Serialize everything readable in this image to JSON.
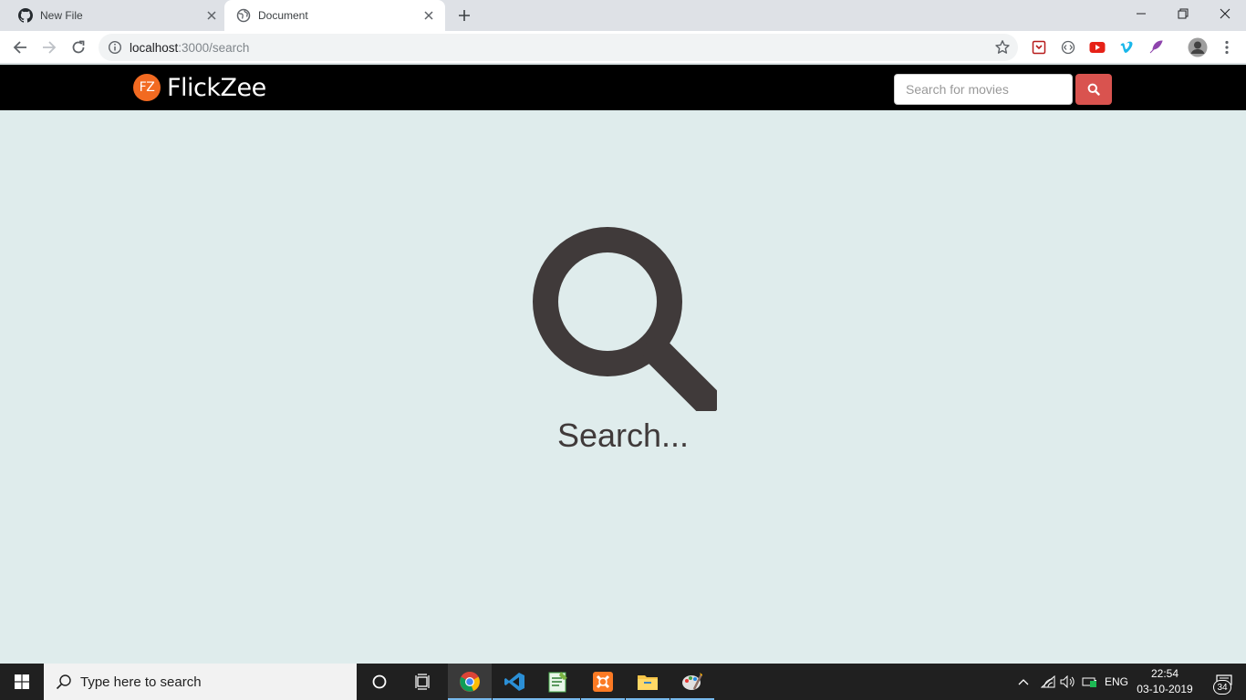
{
  "browser": {
    "tabs": [
      {
        "title": "New File",
        "icon": "github-icon"
      },
      {
        "title": "Document",
        "icon": "globe-icon"
      }
    ],
    "url": {
      "host": "localhost",
      "path": ":3000/search"
    }
  },
  "site": {
    "brand": {
      "logo_text": "FZ",
      "name": "FlickZee",
      "logo_color": "#f26a21"
    },
    "search": {
      "placeholder": "Search for movies",
      "button_color": "#d9534f"
    },
    "nav_background": "#000000"
  },
  "main": {
    "heading": "Search...",
    "icon": "magnifier-icon",
    "background": "#dfecec",
    "icon_color": "#403a3a"
  },
  "taskbar": {
    "search_placeholder": "Type here to search",
    "language": "ENG",
    "time": "22:54",
    "date": "03-10-2019",
    "notification_count": "34"
  }
}
